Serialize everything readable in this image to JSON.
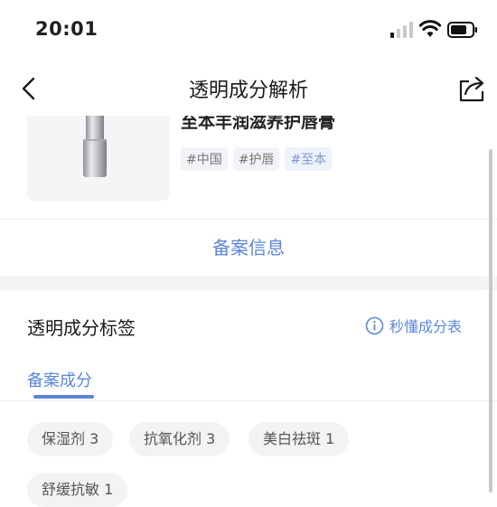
{
  "status_bar": {
    "time": "20:01"
  },
  "nav": {
    "title": "透明成分解析"
  },
  "product": {
    "name": "至本丰润滋养护唇膏",
    "tags": [
      "#中国",
      "#护唇",
      "#至本"
    ]
  },
  "filing_info_label": "备案信息",
  "labels_section": {
    "title": "透明成分标签",
    "quick_read_label": "秒懂成分表",
    "tab_label": "备案成分",
    "chips": [
      "保湿剂 3",
      "抗氧化剂 3",
      "美白祛斑 1",
      "舒缓抗敏 1"
    ]
  },
  "colors": {
    "accent": "#5b86d9",
    "chip_background": "#f3f3f3",
    "section_gap": "#f4f4f6"
  }
}
